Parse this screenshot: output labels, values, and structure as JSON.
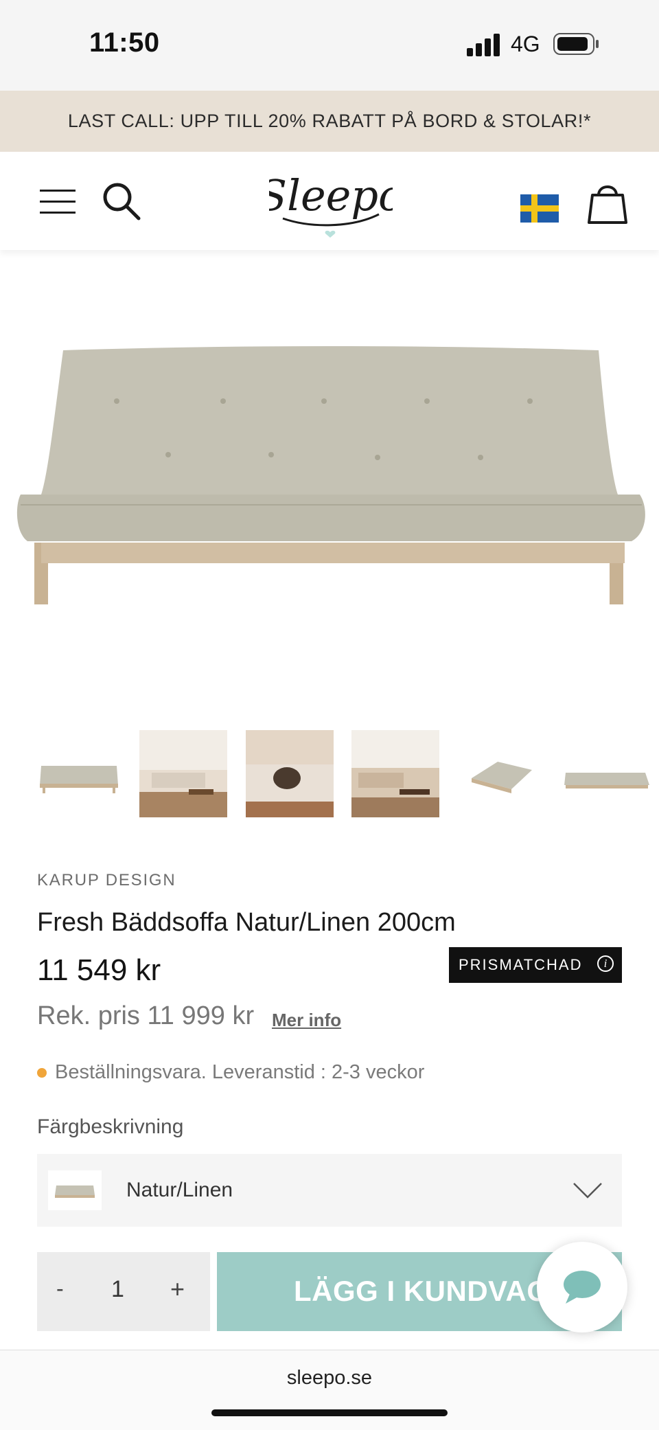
{
  "status_bar": {
    "time": "11:50",
    "network": "4G",
    "icons": [
      "signal-bars-icon",
      "battery-icon"
    ]
  },
  "promo": {
    "text": "LAST CALL: UPP TILL 20% RABATT PÅ BORD & STOLAR!*"
  },
  "header": {
    "icons": [
      "menu-icon",
      "search-icon",
      "sleepo-logo",
      "sweden-flag-icon",
      "cart-icon"
    ],
    "logo_text": "Sleepo"
  },
  "gallery": {
    "thumbnails": [
      "futon-sofa",
      "living-room",
      "dog-on-sofa",
      "living-room-2",
      "sofa-angle",
      "futon-bed"
    ]
  },
  "product": {
    "brand": "KARUP DESIGN",
    "title": "Fresh Bäddsoffa Natur/Linen 200cm",
    "price": "11 549 kr",
    "badge": "PRISMATCHAD",
    "badge_icon": "info-icon",
    "rek_price": "Rek. pris 11 999 kr",
    "more_info": "Mer info",
    "stock_text": "Beställningsvara. Leveranstid : 2-3 veckor",
    "stock_color": "#f0a53a"
  },
  "color_select": {
    "label": "Färgbeskrivning",
    "value": "Natur/Linen"
  },
  "cart": {
    "minus": "-",
    "quantity": "1",
    "plus": "+",
    "add_button": "LÄGG I KUNDVAGN",
    "accent": "#9dccc6"
  },
  "browser": {
    "domain": "sleepo.se"
  }
}
